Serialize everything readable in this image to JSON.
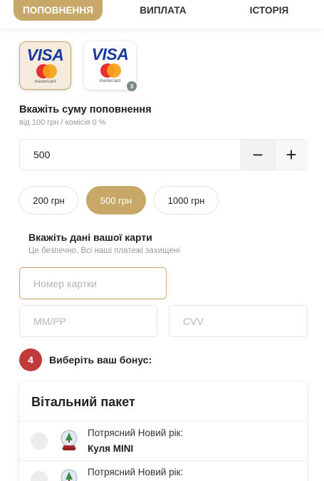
{
  "tabs": [
    {
      "label": "ПОПОВНЕННЯ",
      "active": true
    },
    {
      "label": "ВИПЛАТА",
      "active": false
    },
    {
      "label": "ІСТОРІЯ",
      "active": false
    }
  ],
  "payment_cards": [
    {
      "brand_text": "VISA",
      "sub_text": "mastercard",
      "selected": true
    },
    {
      "brand_text": "VISA",
      "sub_text": "mastercard",
      "selected": false,
      "badge": "3"
    }
  ],
  "amount": {
    "title": "Вкажіть суму поповнення",
    "subtitle": "від 100 грн / комісія 0 %",
    "value": "500",
    "minus_label": "−",
    "plus_label": "+"
  },
  "quick_amounts": [
    {
      "label": "200 грн",
      "active": false
    },
    {
      "label": "500 грн",
      "active": true
    },
    {
      "label": "1000 грн",
      "active": false
    }
  ],
  "card_details": {
    "title": "Вкажіть дані вашої карти",
    "subtitle": "Це безпечно. Всі наші платежі захищені",
    "card_number_placeholder": "Номер картки",
    "expiry_placeholder": "ММ/РР",
    "cvv_placeholder": "CVV"
  },
  "bonus": {
    "step_number": "4",
    "title": "Виберіть ваш бонус:",
    "panel_title": "Вітальний пакет",
    "items": [
      {
        "line1": "Потрясний Новий рік:",
        "line2": "Куля MINI"
      },
      {
        "line1": "Потрясний Новий рік:",
        "line2": ""
      }
    ]
  },
  "colors": {
    "accent": "#c8a868",
    "step_badge": "#c0393b"
  }
}
